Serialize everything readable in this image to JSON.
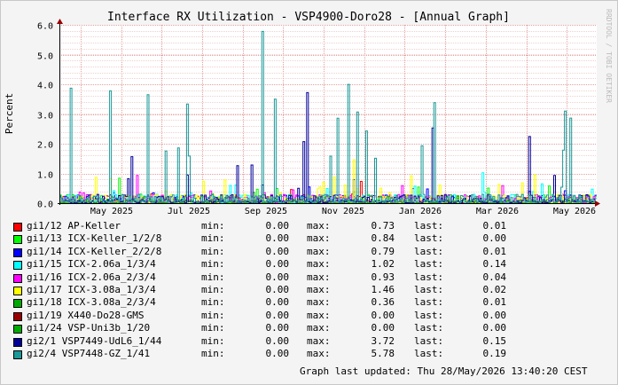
{
  "title": "Interface RX Utilization - VSP4900-Doro28 - [Annual Graph]",
  "watermark": "RRDTOOL / TOBI OETIKER",
  "updated": "Graph last updated: Thu 28/May/2026 13:40:20 CEST",
  "chart_data": {
    "type": "line",
    "ylabel": "Percent",
    "ylim": [
      0,
      6
    ],
    "yticks": [
      "0.0",
      "1.0",
      "2.0",
      "3.0",
      "4.0",
      "5.0",
      "6.0"
    ],
    "xtick_labels": [
      "May 2025",
      "Jul 2025",
      "Sep 2025",
      "Nov 2025",
      "Jan 2026",
      "Mar 2026",
      "May 2026"
    ],
    "grid": true,
    "series": [
      {
        "name": "gi1/12 AP-Keller",
        "color": "#ff0000",
        "min": "0.00",
        "max": "0.73",
        "last": "0.01",
        "peak": 0.73
      },
      {
        "name": "gi1/13 ICX-Keller_1/2/8",
        "color": "#00ff00",
        "min": "0.00",
        "max": "0.84",
        "last": "0.00",
        "peak": 0.84
      },
      {
        "name": "gi1/14 ICX-Keller_2/2/8",
        "color": "#0000ff",
        "min": "0.00",
        "max": "0.79",
        "last": "0.01",
        "peak": 0.79
      },
      {
        "name": "gi1/15 ICX-2.06a_1/3/4",
        "color": "#00ffff",
        "min": "0.00",
        "max": "1.02",
        "last": "0.14",
        "peak": 1.02
      },
      {
        "name": "gi1/16 ICX-2.06a_2/3/4",
        "color": "#ff00ff",
        "min": "0.00",
        "max": "0.93",
        "last": "0.04",
        "peak": 0.93
      },
      {
        "name": "gi1/17 ICX-3.08a_1/3/4",
        "color": "#ffff00",
        "min": "0.00",
        "max": "1.46",
        "last": "0.02",
        "peak": 1.46
      },
      {
        "name": "gi1/18 ICX-3.08a_2/3/4",
        "color": "#00aa00",
        "min": "0.00",
        "max": "0.36",
        "last": "0.01",
        "peak": 0.36
      },
      {
        "name": "gi1/19 X440-Do28-GMS",
        "color": "#990000",
        "min": "0.00",
        "max": "0.00",
        "last": "0.00",
        "peak": 0.0
      },
      {
        "name": "gi1/24 VSP-Uni3b_1/20",
        "color": "#00aa00",
        "min": "0.00",
        "max": "0.00",
        "last": "0.00",
        "peak": 0.0
      },
      {
        "name": "gi2/1 VSP7449-UdL6_1/44",
        "color": "#000099",
        "min": "0.00",
        "max": "3.72",
        "last": "0.15",
        "peak": 3.72
      },
      {
        "name": "gi2/4 VSP7448-GZ_1/41",
        "color": "#199999",
        "min": "0.00",
        "max": "5.78",
        "last": "0.19",
        "peak": 5.78
      }
    ]
  },
  "legend": {
    "min_label": "min:",
    "max_label": "max:",
    "last_label": "last:"
  }
}
